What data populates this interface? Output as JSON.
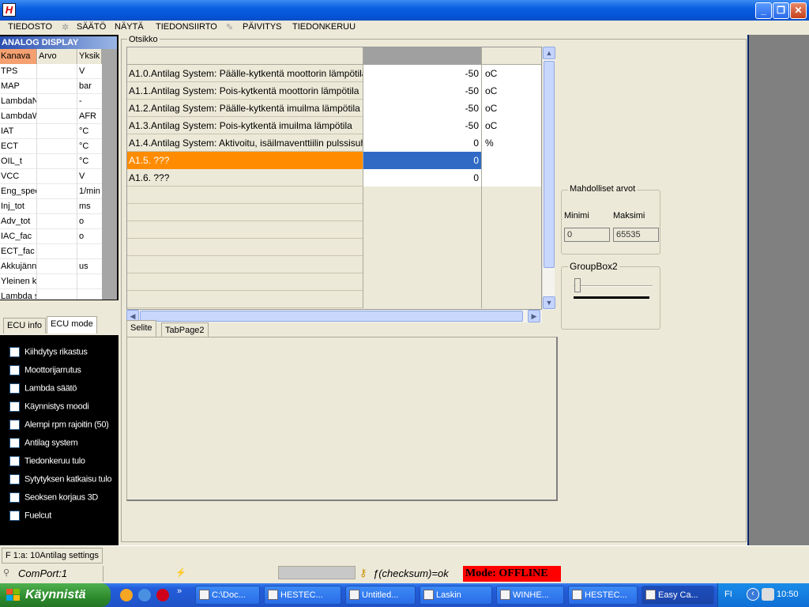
{
  "menu": {
    "items": [
      "TIEDOSTO",
      "SÄÄTÖ",
      "NÄYTÄ",
      "TIEDONSIIRTO",
      "PÄIVITYS",
      "TIEDONKERUU"
    ]
  },
  "analog": {
    "title": "ANALOG DISPLAY",
    "headers": [
      "Kanava",
      "Arvo",
      "Yksik"
    ],
    "rows": [
      {
        "name": "TPS",
        "value": "",
        "unit": "V"
      },
      {
        "name": "MAP",
        "value": "",
        "unit": "bar"
      },
      {
        "name": "LambdaN",
        "value": "",
        "unit": "-"
      },
      {
        "name": "LambdaW",
        "value": "",
        "unit": "AFR"
      },
      {
        "name": "IAT",
        "value": "",
        "unit": "°C"
      },
      {
        "name": "ECT",
        "value": "",
        "unit": "°C"
      },
      {
        "name": "OIL_t",
        "value": "",
        "unit": "°C"
      },
      {
        "name": "VCC",
        "value": "",
        "unit": "V"
      },
      {
        "name": "Eng_spee",
        "value": "",
        "unit": "1/min"
      },
      {
        "name": "Inj_tot",
        "value": "",
        "unit": "ms"
      },
      {
        "name": "Adv_tot",
        "value": "",
        "unit": "o"
      },
      {
        "name": "IAC_fac",
        "value": "",
        "unit": "o"
      },
      {
        "name": "ECT_fac",
        "value": "",
        "unit": ""
      },
      {
        "name": "Akkujänni",
        "value": "",
        "unit": "us"
      },
      {
        "name": "Yleinen k",
        "value": "",
        "unit": ""
      },
      {
        "name": "Lambda s",
        "value": "",
        "unit": ""
      }
    ]
  },
  "ecu_tabs": [
    "ECU info",
    "ECU mode"
  ],
  "ecu_items": [
    "Kiihdytys rikastus",
    "Moottorijarrutus",
    "Lambda säätö",
    "Käynnistys moodi",
    "Alempi rpm rajoitin (50)",
    "Antilag system",
    "Tiedonkeruu tulo",
    "Sytytyksen katkaisu tulo",
    "Seoksen korjaus 3D",
    "Fuelcut"
  ],
  "main": {
    "frame_label": "Otsikko",
    "rows": [
      {
        "desc": "A1.0.Antilag System: Päälle-kytkentä moottorin lämpötila",
        "value": "-50",
        "unit": "oC"
      },
      {
        "desc": "A1.1.Antilag System: Pois-kytkentä moottorin lämpötila",
        "value": "-50",
        "unit": "oC"
      },
      {
        "desc": "A1.2.Antilag System: Päälle-kytkentä imuilma lämpötila",
        "value": "-50",
        "unit": "oC"
      },
      {
        "desc": "A1.3.Antilag System: Pois-kytkentä imuilma lämpötila",
        "value": "-50",
        "unit": "oC"
      },
      {
        "desc": "A1.4.Antilag System: Aktivoitu, isäilmaventtiilin pulssisuhde",
        "value": "0",
        "unit": "%"
      },
      {
        "desc": "A1.5. ???",
        "value": "0",
        "unit": ""
      },
      {
        "desc": "A1.6. ???",
        "value": "0",
        "unit": ""
      }
    ],
    "lower_tabs": [
      "Selite",
      "TabPage2"
    ]
  },
  "possible_values": {
    "title": "Mahdolliset arvot",
    "min_label": "Minimi",
    "max_label": "Maksimi",
    "min_value": "0",
    "max_value": "65535"
  },
  "groupbox2": {
    "title": "GroupBox2"
  },
  "status": {
    "panel1": "F 1:a:  10Antilag settings",
    "comport": "ComPort:1",
    "checksum": "ƒ(checksum)=ok",
    "mode": "Mode: OFFLINE"
  },
  "taskbar": {
    "start": "Käynnistä",
    "buttons": [
      "C:\\Doc...",
      "HESTEC...",
      "Untitled...",
      "Laskin",
      "WINHE...",
      "HESTEC...",
      "Easy Ca..."
    ],
    "lang": "FI",
    "clock": "10:50"
  },
  "colors": {
    "selected_desc": "#ff8c00",
    "selected_value": "#316ac5",
    "offline": "#ff0000"
  }
}
